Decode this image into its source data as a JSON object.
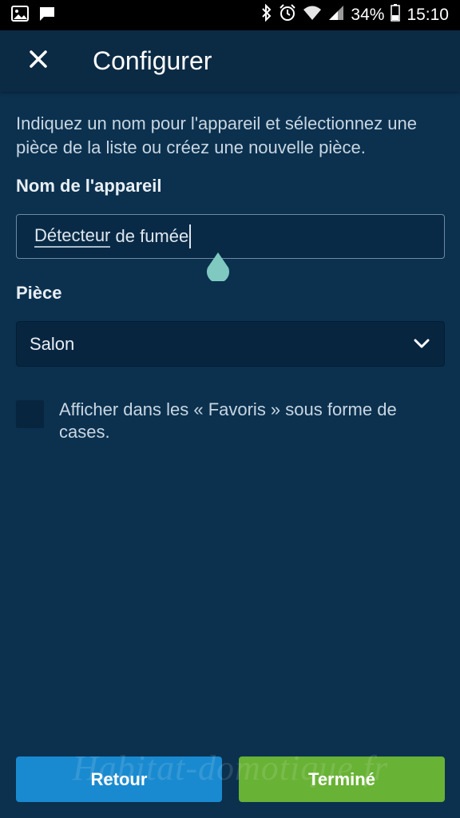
{
  "status_bar": {
    "battery": "34%",
    "time": "15:10",
    "icons": [
      "gallery-icon",
      "message-icon",
      "bluetooth-icon",
      "alarm-icon",
      "wifi-icon",
      "signal-icon",
      "battery-icon"
    ]
  },
  "header": {
    "title": "Configurer",
    "close_icon": "close-icon"
  },
  "intro_text": "Indiquez un nom pour l'appareil et sélectionnez une pièce de la liste ou créez une nouvelle pièce.",
  "device_name": {
    "label": "Nom de l'appareil",
    "value_part1": "Détecteur",
    "value_part2": " de fumée"
  },
  "room": {
    "label": "Pièce",
    "selected": "Salon"
  },
  "favorites_checkbox": {
    "label": "Afficher dans les « Favoris » sous forme de cases.",
    "checked": false
  },
  "footer": {
    "back_label": "Retour",
    "done_label": "Terminé",
    "watermark": "Habitat-domotique.fr"
  },
  "colors": {
    "background": "#0b314f",
    "back_button": "#1a8ad0",
    "done_button": "#68b235",
    "cursor_handle": "#7fc9c0"
  }
}
